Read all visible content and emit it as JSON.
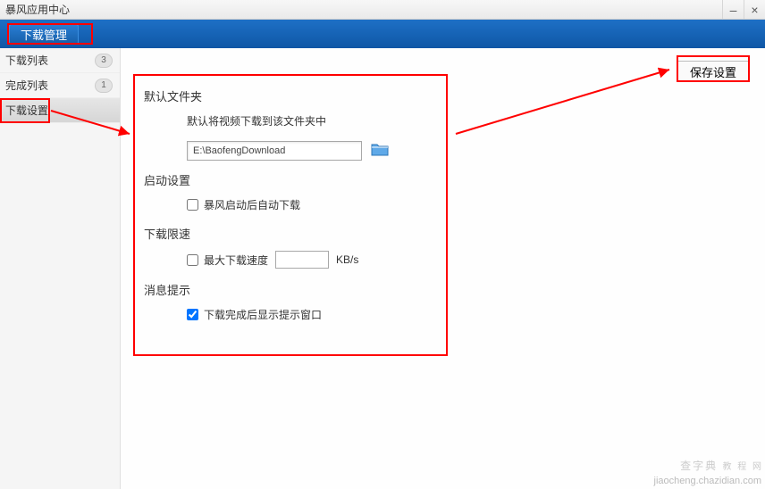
{
  "window": {
    "title": "暴风应用中心"
  },
  "header": {
    "tab_label": "下载管理"
  },
  "sidebar": {
    "items": [
      {
        "label": "下载列表",
        "badge": "3"
      },
      {
        "label": "完成列表",
        "badge": "1"
      },
      {
        "label": "下载设置"
      }
    ]
  },
  "actions": {
    "save_label": "保存设置"
  },
  "settings": {
    "default_folder": {
      "title": "默认文件夹",
      "hint": "默认将视频下载到该文件夹中",
      "path": "E:\\BaofengDownload"
    },
    "startup": {
      "title": "启动设置",
      "auto_label": "暴风启动后自动下载"
    },
    "speed_limit": {
      "title": "下载限速",
      "max_label": "最大下载速度",
      "value": "",
      "unit": "KB/s"
    },
    "message": {
      "title": "消息提示",
      "popup_label": "下载完成后显示提示窗口"
    }
  },
  "watermark": {
    "line1": "查字典",
    "line2": "教 程 网",
    "url": "jiaocheng.chazidian.com"
  }
}
